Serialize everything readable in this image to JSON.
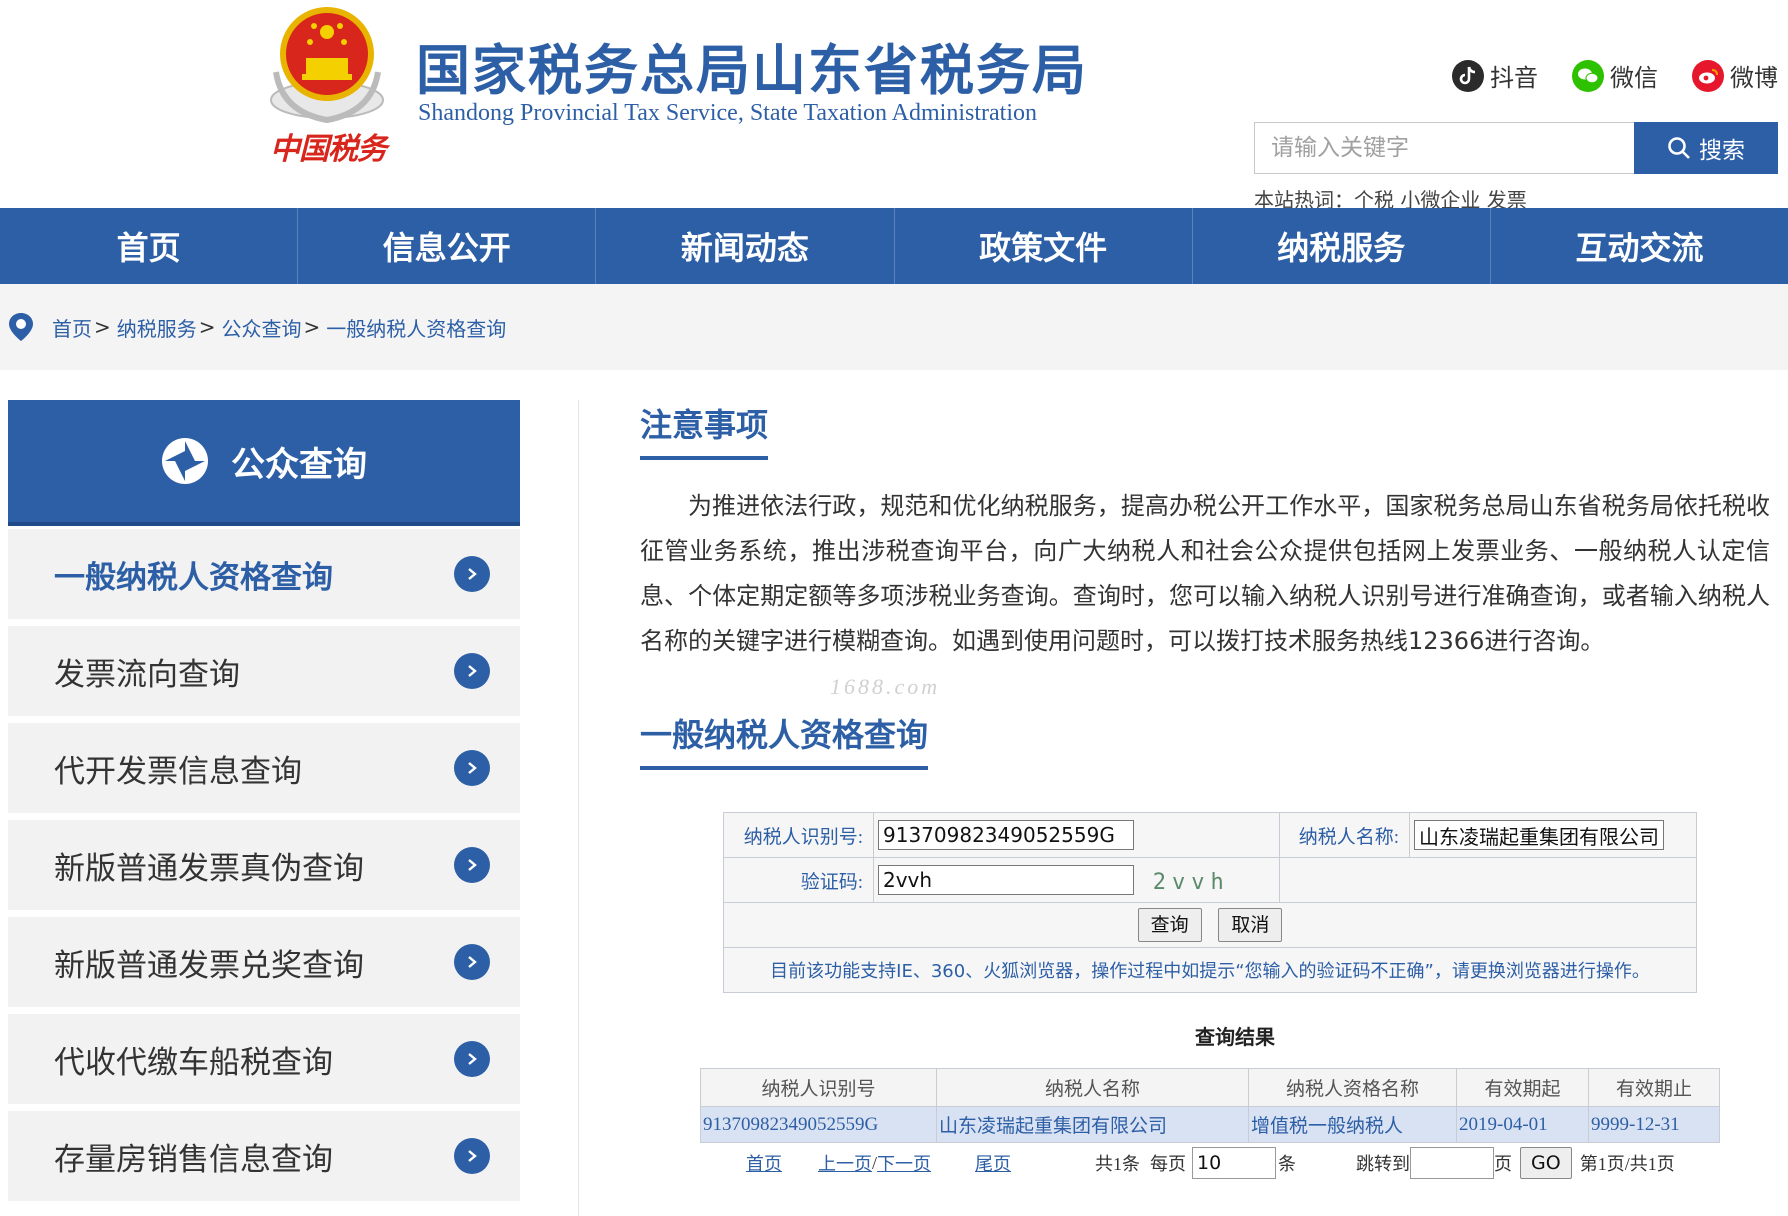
{
  "header": {
    "title_cn": "国家税务总局山东省税务局",
    "title_en": "Shandong Provincial Tax Service, State Taxation Administration",
    "logo_text": "中国税务",
    "social": [
      {
        "label": "抖音",
        "icon": "douyin-icon",
        "color": "#2b2b2b"
      },
      {
        "label": "微信",
        "icon": "wechat-icon",
        "color": "#2ec100"
      },
      {
        "label": "微博",
        "icon": "weibo-icon",
        "color": "#e6162d"
      }
    ],
    "search": {
      "placeholder": "请输入关键字",
      "button_label": "搜索"
    },
    "hotwords": "本站热词：个税 小微企业 发票"
  },
  "nav": [
    "首页",
    "信息公开",
    "新闻动态",
    "政策文件",
    "纳税服务",
    "互动交流"
  ],
  "breadcrumb": [
    "首页",
    "纳税服务",
    "公众查询",
    "一般纳税人资格查询"
  ],
  "sidebar": {
    "title": "公众查询",
    "items": [
      {
        "label": "一般纳税人资格查询",
        "active": true
      },
      {
        "label": "发票流向查询",
        "active": false
      },
      {
        "label": "代开发票信息查询",
        "active": false
      },
      {
        "label": "新版普通发票真伪查询",
        "active": false
      },
      {
        "label": "新版普通发票兑奖查询",
        "active": false
      },
      {
        "label": "代收代缴车船税查询",
        "active": false
      },
      {
        "label": "存量房销售信息查询",
        "active": false
      }
    ]
  },
  "notice": {
    "title": "注意事项",
    "text": "为推进依法行政，规范和优化纳税服务，提高办税公开工作水平，国家税务总局山东省税务局依托税收征管业务系统，推出涉税查询平台，向广大纳税人和社会公众提供包括网上发票业务、一般纳税人认定信息、个体定期定额等多项涉税业务查询。查询时，您可以输入纳税人识别号进行准确查询，或者输入纳税人名称的关键字进行模糊查询。如遇到使用问题时，可以拨打技术服务热线12366进行咨询。",
    "watermark": "1688.com"
  },
  "query": {
    "title": "一般纳税人资格查询",
    "taxpayer_id_label": "纳税人识别号:",
    "taxpayer_id_value": "91370982349052559G",
    "taxpayer_name_label": "纳税人名称:",
    "taxpayer_name_value": "山东凌瑞起重集团有限公司",
    "captcha_label": "验证码:",
    "captcha_value": "2vvh",
    "captcha_image_text": "2vvh",
    "query_button": "查询",
    "cancel_button": "取消",
    "tip": "目前该功能支持IE、360、火狐浏览器，操作过程中如提示“您输入的验证码不正确”，请更换浏览器进行操作。"
  },
  "result": {
    "title": "查询结果",
    "headers": [
      "纳税人识别号",
      "纳税人名称",
      "纳税人资格名称",
      "有效期起",
      "有效期止"
    ],
    "rows": [
      [
        "91370982349052559G",
        "山东凌瑞起重集团有限公司",
        "增值税一般纳税人",
        "2019-04-01",
        "9999-12-31"
      ]
    ]
  },
  "pager": {
    "first": "首页",
    "prev": "上一页",
    "slash": "/",
    "next": "下一页",
    "last": "尾页",
    "total": "共1条",
    "per_page_label": "每页",
    "per_page_value": "10",
    "per_page_unit": "条",
    "jump_label": "跳转到",
    "jump_value": "",
    "page_unit": "页",
    "go_button": "GO",
    "page_info": "第1页/共1页"
  },
  "colors": {
    "brand": "#2d5fa6",
    "logo_red": "#d8261c"
  }
}
